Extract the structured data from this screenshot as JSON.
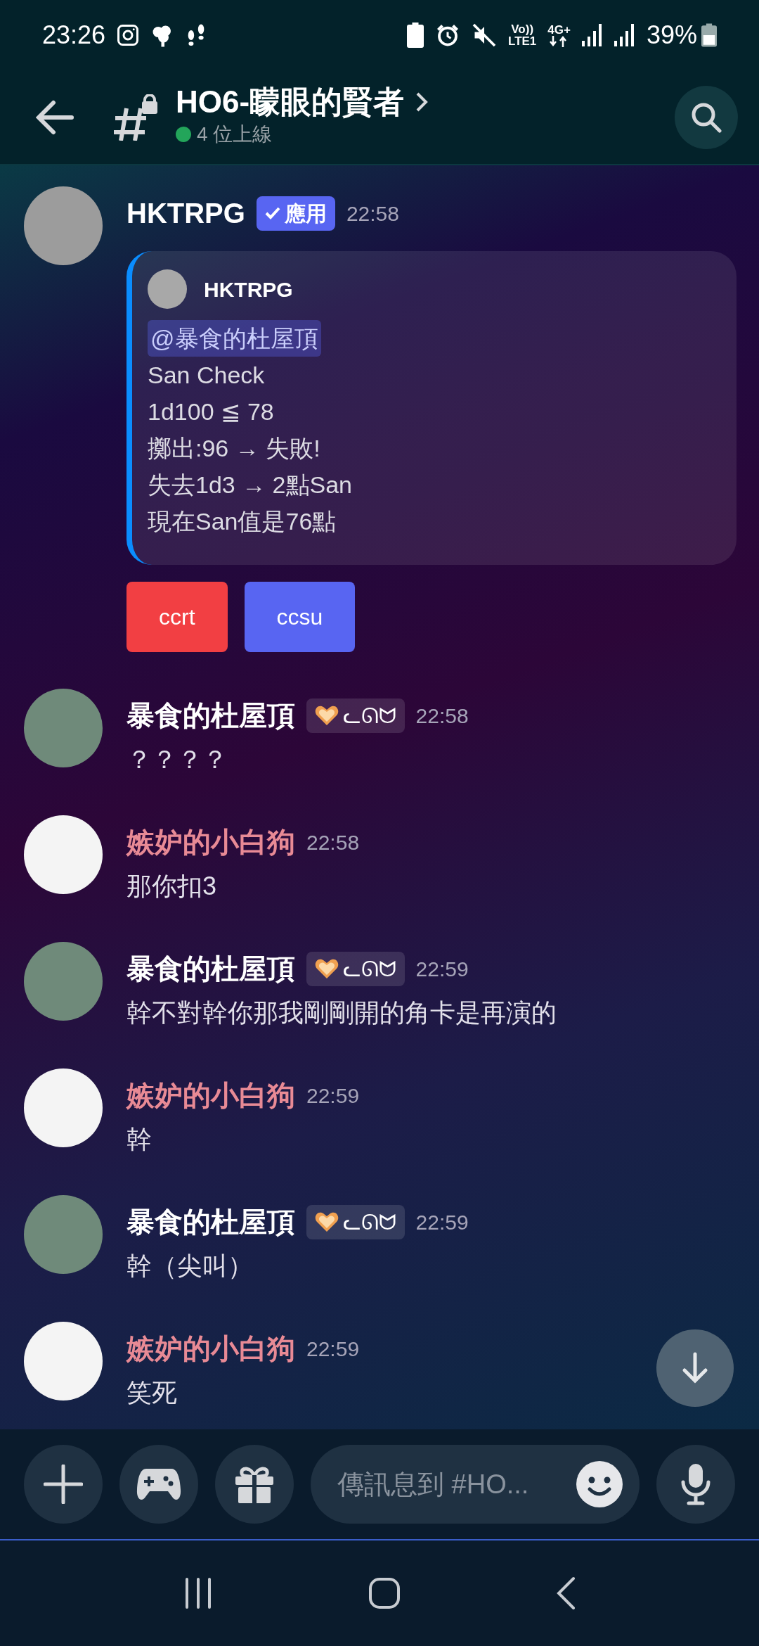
{
  "status_bar": {
    "time": "23:26",
    "volte_top": "Vo))",
    "volte_bottom": "LTE1",
    "network": "4G+",
    "battery": "39%"
  },
  "header": {
    "channel": "HO6-矇眼的賢者",
    "online": "4 位上線"
  },
  "messages": [
    {
      "kind": "bot",
      "author": "HKTRPG",
      "color": "#ffffff",
      "tag": {
        "kind": "app",
        "label": "應用"
      },
      "time": "22:58",
      "embed": {
        "author": "HKTRPG",
        "lines": [
          {
            "kind": "mention",
            "text": "@暴食的杜屋頂"
          },
          {
            "kind": "text",
            "text": "San Check"
          },
          {
            "kind": "text",
            "text": "1d100 ≦ 78"
          },
          {
            "kind": "text",
            "text": "擲出:96 → 失敗!"
          },
          {
            "kind": "text",
            "text": "失去1d3 → 2點San"
          },
          {
            "kind": "text",
            "text": "現在San值是76點"
          }
        ]
      },
      "buttons": [
        {
          "label": "ccrt",
          "color": "#f23f43"
        },
        {
          "label": "ccsu",
          "color": "#5865f2"
        }
      ]
    },
    {
      "kind": "user",
      "author": "暴食的杜屋頂",
      "color": "#ffffff",
      "tag": {
        "kind": "guild",
        "label": "ᓚᘏᗢ"
      },
      "time": "22:58",
      "text": "？？？？"
    },
    {
      "kind": "user",
      "author": "嫉妒的小白狗",
      "color": "#e88a95",
      "time": "22:58",
      "text": "那你扣3"
    },
    {
      "kind": "user",
      "author": "暴食的杜屋頂",
      "color": "#ffffff",
      "tag": {
        "kind": "guild",
        "label": "ᓚᘏᗢ"
      },
      "time": "22:59",
      "text": "幹不對幹你那我剛剛開的角卡是再演的"
    },
    {
      "kind": "user",
      "author": "嫉妒的小白狗",
      "color": "#e88a95",
      "time": "22:59",
      "text": "幹"
    },
    {
      "kind": "user",
      "author": "暴食的杜屋頂",
      "color": "#ffffff",
      "tag": {
        "kind": "guild",
        "label": "ᓚᘏᗢ"
      },
      "time": "22:59",
      "text": "幹（尖叫）"
    },
    {
      "kind": "user",
      "author": "嫉妒的小白狗",
      "color": "#e88a95",
      "time": "22:59",
      "text": "笑死"
    }
  ],
  "composer": {
    "placeholder": "傳訊息到 #HO..."
  }
}
